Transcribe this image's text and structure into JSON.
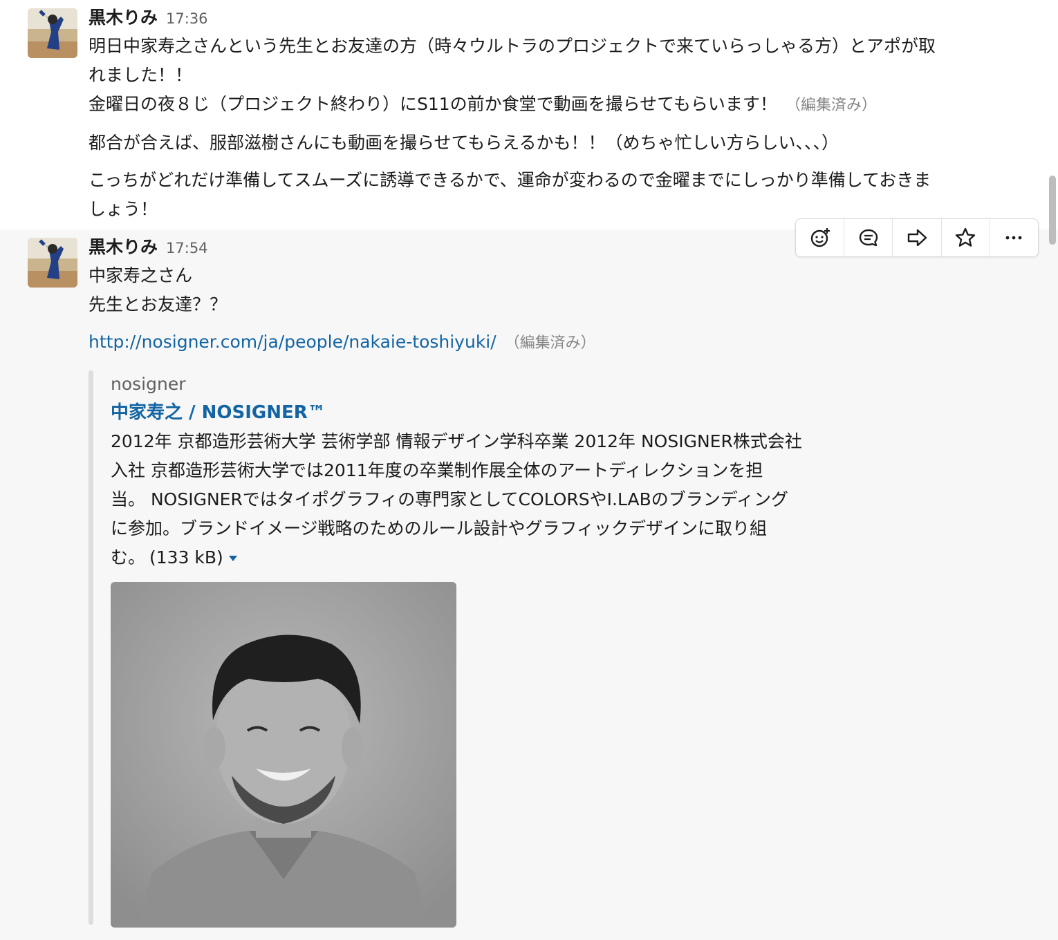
{
  "messages": [
    {
      "sender": "黒木りみ",
      "time": "17:36",
      "lines": [
        "明日中家寿之さんという先生とお友達の方（時々ウルトラのプロジェクトで来ていらっしゃる方）とアポが取",
        "れました！！",
        "金曜日の夜８じ（プロジェクト終わり）にS11の前か食堂で動画を撮らせてもらいます！",
        "都合が合えば、服部滋樹さんにも動画を撮らせてもらえるかも！！（めちゃ忙しい方らしい、、、）",
        "こっちがどれだけ準備してスムーズに誘導できるかで、運命が変わるので金曜までにしっかり準備しておきま",
        "しょう！"
      ],
      "edited": "（編集済み）"
    },
    {
      "sender": "黒木りみ",
      "time": "17:54",
      "lines": [
        "中家寿之さん",
        "先生とお友達？？"
      ],
      "link": "http://nosigner.com/ja/people/nakaie-toshiyuki/",
      "edited": "（編集済み）",
      "attachment": {
        "site": "nosigner",
        "title": "中家寿之 / NOSIGNER™",
        "description_lines": [
          "2012年 京都造形芸術大学 芸術学部 情報デザイン学科卒業 2012年 NOSIGNER株式会社",
          "入社 京都造形芸術大学では2011年度の卒業制作展全体のアートディレクションを担",
          "当。 NOSIGNERではタイポグラフィの専門家としてCOLORSやI.LABのブランディング",
          "に参加。ブランドイメージ戦略のためのルール設計やグラフィックデザインに取り組",
          "む。"
        ],
        "size": "(133 kB)"
      }
    }
  ],
  "toolbar": {
    "icons": [
      "add-reaction-icon",
      "reply-thread-icon",
      "share-icon",
      "star-icon",
      "more-actions-icon"
    ]
  },
  "colors": {
    "link": "#1264a3",
    "hover_bg": "#f7f7f7",
    "muted": "#616061"
  }
}
